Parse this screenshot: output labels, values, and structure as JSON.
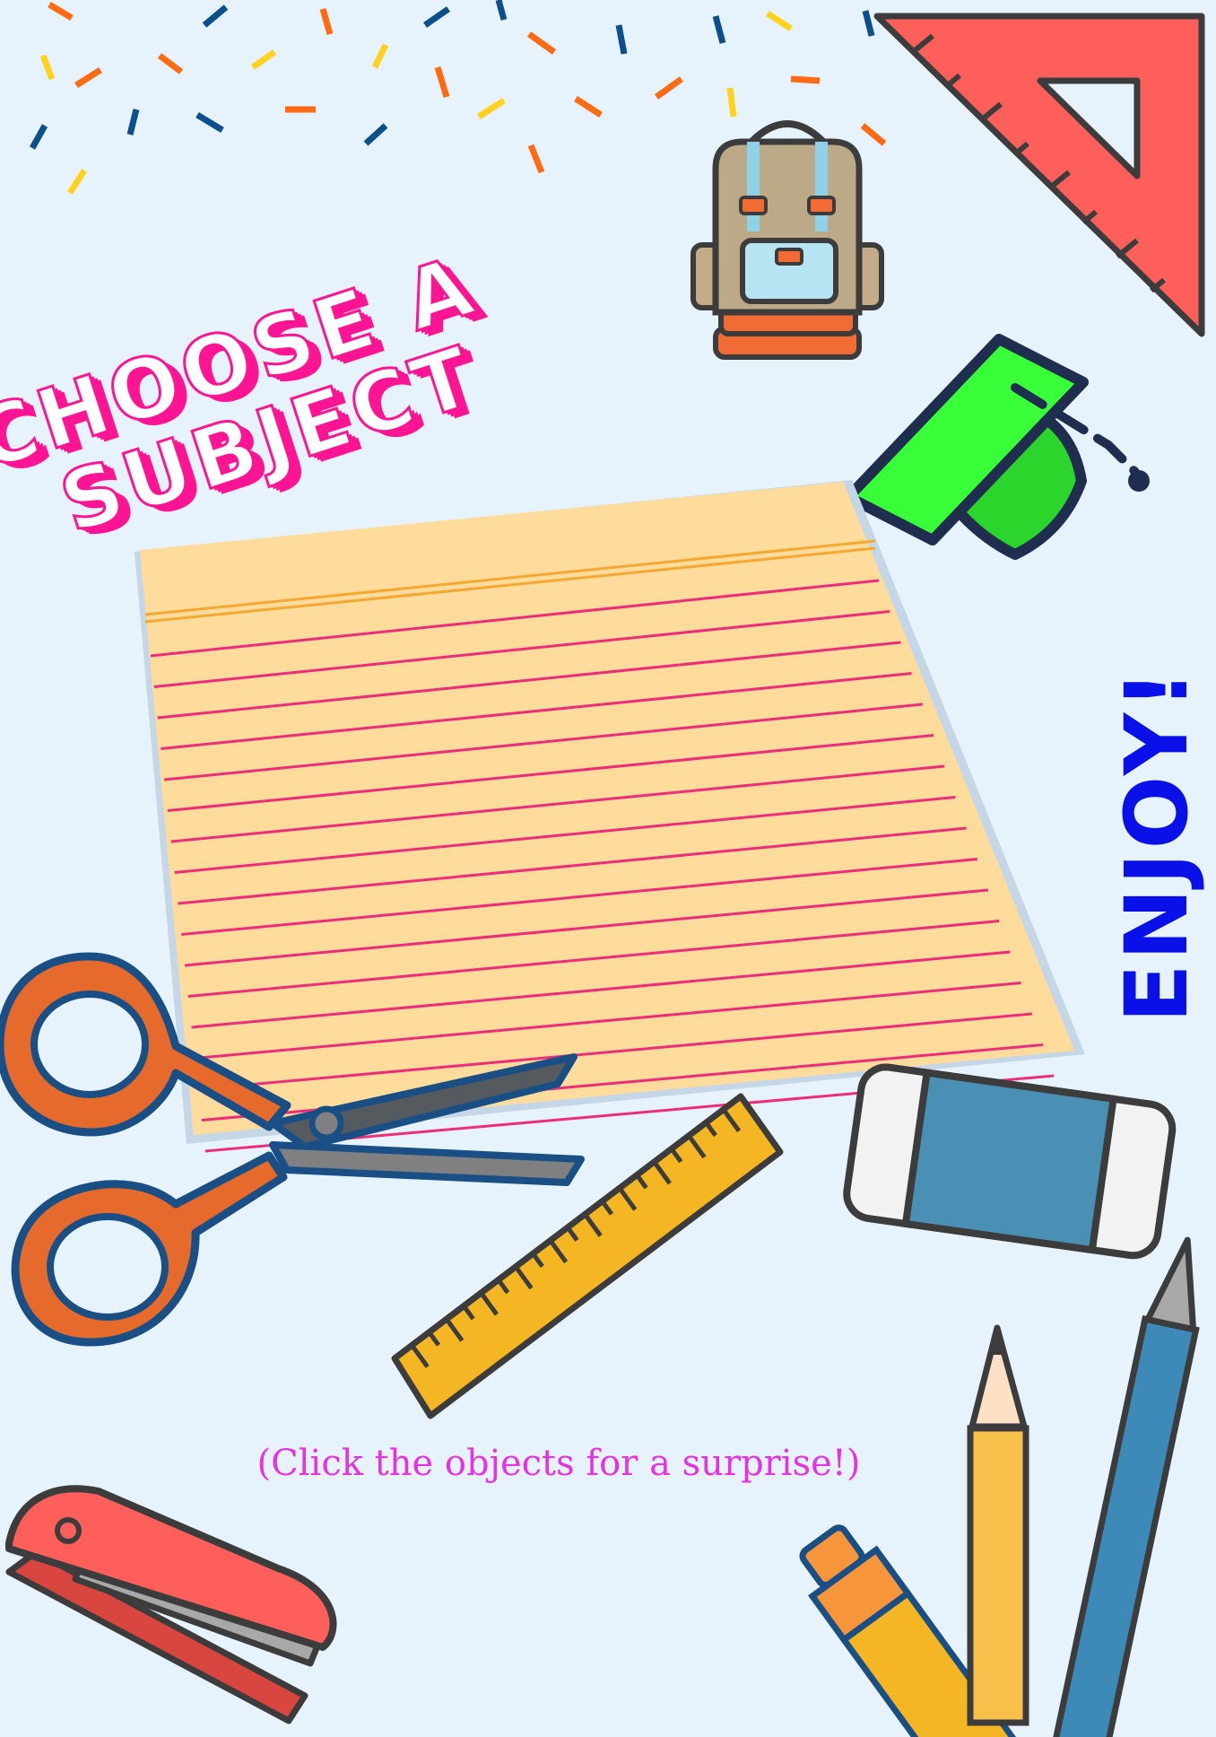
{
  "title": {
    "line1": "CHOOSE A",
    "line2": "SUBJECT"
  },
  "side_text": "ENJOY!",
  "hint": "(Click the objects for a surprise!)",
  "objects": [
    {
      "name": "set-square",
      "icon": "set-square-icon"
    },
    {
      "name": "backpack",
      "icon": "backpack-icon"
    },
    {
      "name": "graduation-cap",
      "icon": "graduation-cap-icon"
    },
    {
      "name": "index-card",
      "icon": "index-card-icon"
    },
    {
      "name": "scissors",
      "icon": "scissors-icon"
    },
    {
      "name": "ruler",
      "icon": "ruler-icon"
    },
    {
      "name": "eraser",
      "icon": "eraser-icon"
    },
    {
      "name": "stapler",
      "icon": "stapler-icon"
    },
    {
      "name": "highlighter",
      "icon": "highlighter-icon"
    },
    {
      "name": "pencil",
      "icon": "pencil-icon"
    },
    {
      "name": "blue-pencil",
      "icon": "pencil-icon"
    }
  ],
  "colors": {
    "background": "#e6f3fd",
    "title_accent": "#ff1493",
    "side_text": "#0a10e8",
    "hint": "#e632e6",
    "confetti": [
      "#ff6a13",
      "#0b4f8c",
      "#ffd21f"
    ]
  }
}
